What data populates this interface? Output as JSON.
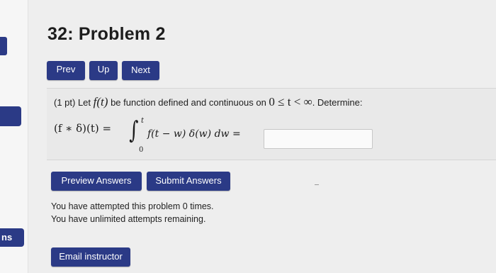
{
  "header": {
    "title": "32: Problem 2"
  },
  "sidebar": {
    "tab_label": "ns"
  },
  "nav": {
    "prev": "Prev",
    "up": "Up",
    "next": "Next"
  },
  "problem": {
    "intro": "(1 pt) Let",
    "func": "f(t)",
    "mid": "be function defined and continuous on",
    "range_math": "0 ≤ t < ∞",
    "outro": ". Determine:",
    "formula_lhs": "(f ∗ δ)(t) =",
    "integral_sign": "∫",
    "integral_upper": "t",
    "integral_lower": "0",
    "integrand": "f(t − w) δ(w) dw  =",
    "answer_value": ""
  },
  "actions": {
    "preview": "Preview Answers",
    "submit": "Submit Answers"
  },
  "status": {
    "attempts": "You have attempted this problem 0 times.",
    "remaining": "You have unlimited attempts remaining."
  },
  "footer": {
    "email": "Email instructor"
  },
  "colors": {
    "button": "#2b3a86",
    "background": "#eeeeee"
  }
}
